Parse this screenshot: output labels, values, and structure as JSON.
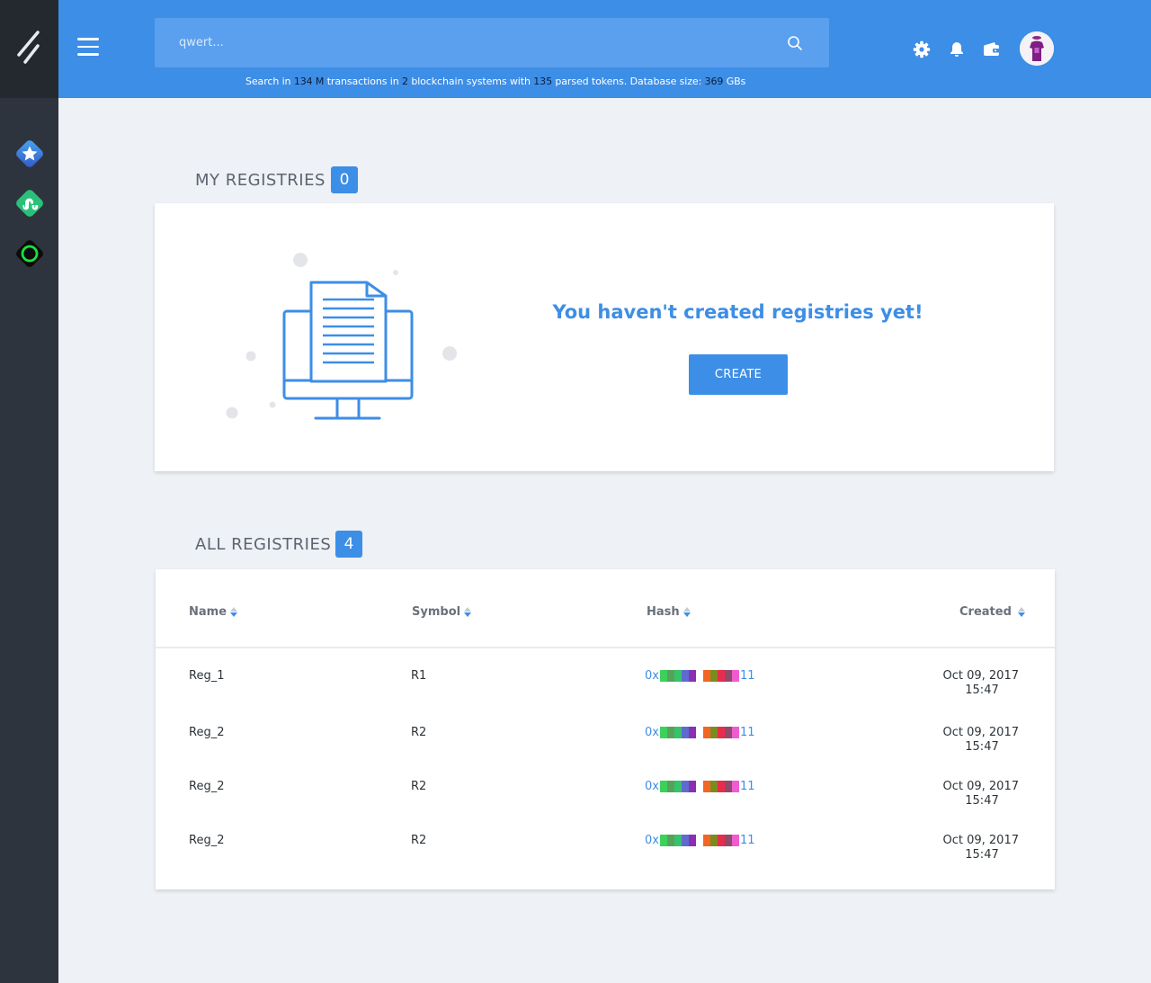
{
  "header": {
    "search": {
      "placeholder": "qwert..."
    },
    "stats": {
      "prefix": "Search in",
      "transactions": "134 M",
      "transactions_label": "transactions in",
      "systems": "2",
      "systems_label": "blockchain systems with",
      "tokens": "135",
      "tokens_label": "parsed tokens. Database size:",
      "db_size": "369",
      "db_unit": "GBs"
    },
    "icons": [
      "gear-icon",
      "bell-icon",
      "wallet-icon"
    ]
  },
  "sidebar": {
    "items": [
      {
        "name": "star-app",
        "color": "#3a7ee0"
      },
      {
        "name": "stumbleupon-app",
        "color": "#2bc07a"
      },
      {
        "name": "ring-app",
        "color": "#19e33a"
      }
    ]
  },
  "my_registries": {
    "title": "MY REGISTRIES",
    "count": "0",
    "empty_message": "You haven't created registries yet!",
    "create_label": "CREATE"
  },
  "all_registries": {
    "title": "ALL REGISTRIES",
    "count": "4",
    "columns": {
      "name": "Name",
      "symbol": "Symbol",
      "hash": "Hash",
      "created": "Created"
    },
    "rows": [
      {
        "name": "Reg_1",
        "symbol": "R1",
        "hash_prefix": "0x",
        "hash_suffix": "11",
        "created_date": "Oct 09, 2017",
        "created_time": "15:47"
      },
      {
        "name": "Reg_2",
        "symbol": "R2",
        "hash_prefix": "0x",
        "hash_suffix": "11",
        "created_date": "Oct 09, 2017",
        "created_time": "15:47"
      },
      {
        "name": "Reg_2",
        "symbol": "R2",
        "hash_prefix": "0x",
        "hash_suffix": "11",
        "created_date": "Oct 09, 2017",
        "created_time": "15:47"
      },
      {
        "name": "Reg_2",
        "symbol": "R2",
        "hash_prefix": "0x",
        "hash_suffix": "11",
        "created_date": "Oct 09, 2017",
        "created_time": "15:47"
      }
    ],
    "hash_colors": [
      "#3bd15a",
      "#55a35a",
      "#36c36b",
      "#5f6bd1",
      "#8a2fb3",
      "#ffffff",
      "#f26522",
      "#7c8b1e",
      "#e62d4d",
      "#8e4a6a",
      "#f05bd0"
    ]
  },
  "colors": {
    "accent": "#3d8ee6",
    "sidebar": "#2d343d",
    "background": "#eef1f5"
  }
}
